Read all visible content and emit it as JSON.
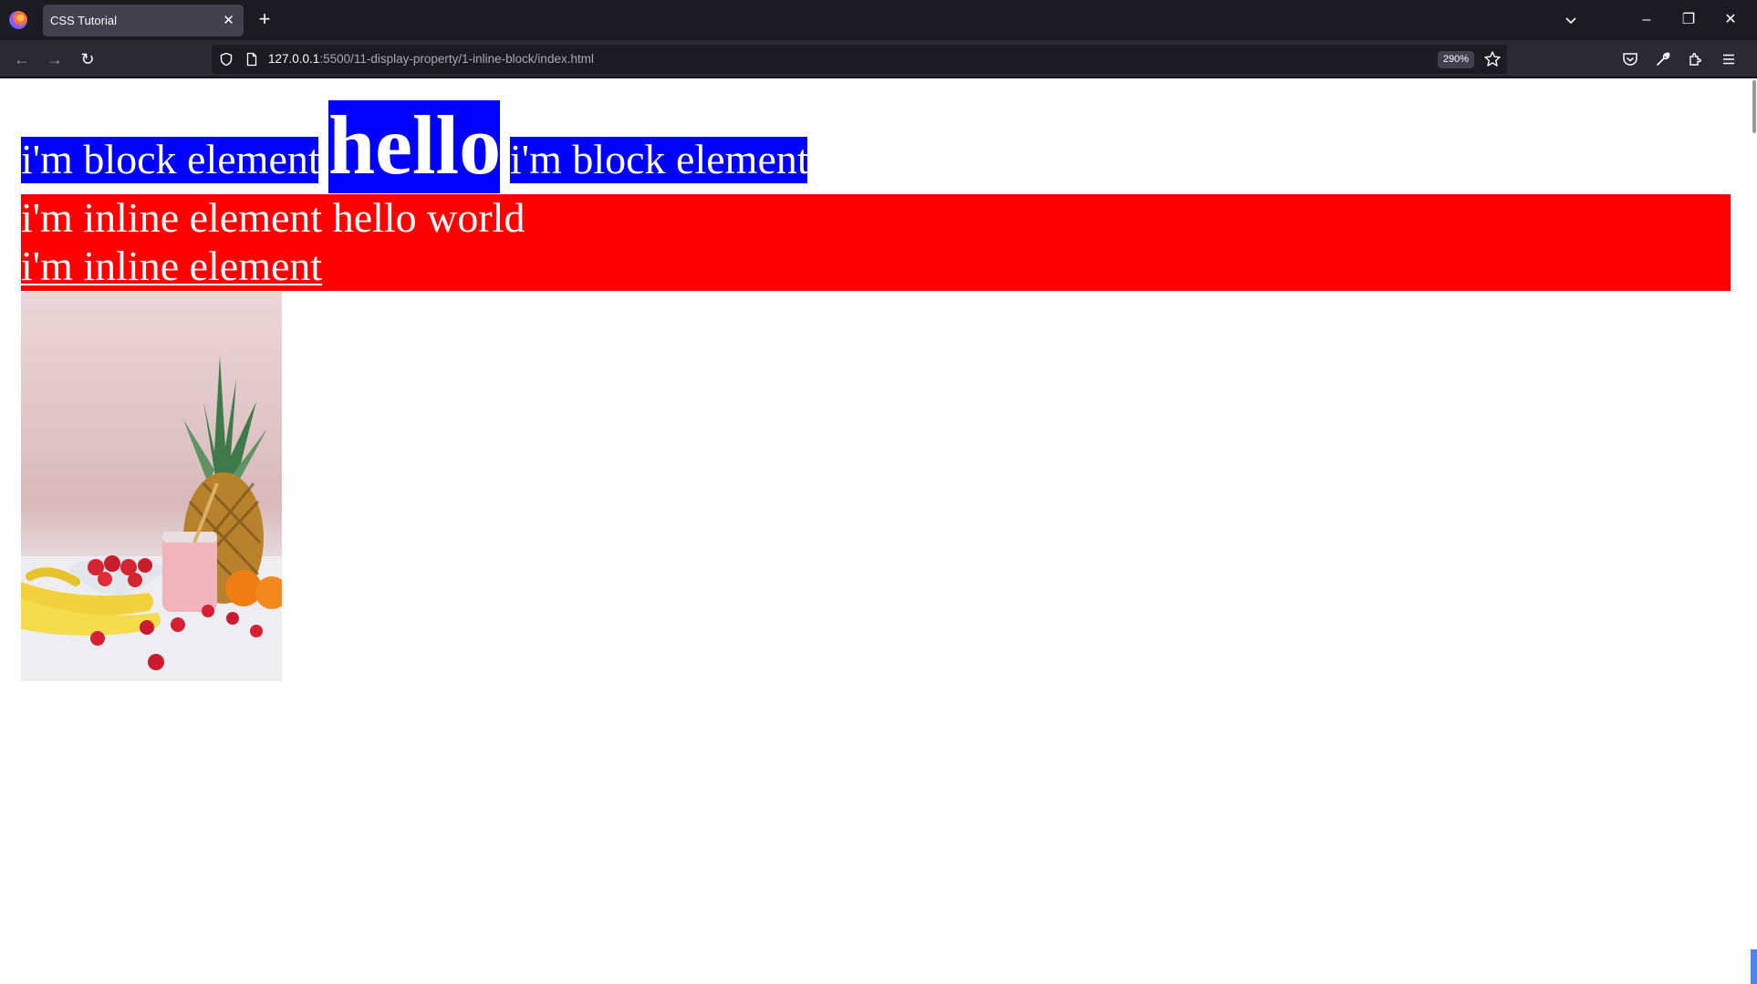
{
  "browser": {
    "tab": {
      "title": "CSS Tutorial",
      "close_glyph": "✕"
    },
    "new_tab_glyph": "+",
    "tablist_glyph": "⌄",
    "window_controls": {
      "minimize": "–",
      "restore": "❐",
      "close": "✕"
    },
    "nav": {
      "back_glyph": "←",
      "forward_glyph": "→",
      "reload_glyph": "↻"
    },
    "url": {
      "host": "127.0.0.1",
      "path": ":5500/11-display-property/1-inline-block/index.html"
    },
    "zoom_level": "290%",
    "icons": [
      "firefox-logo",
      "shield-icon",
      "page-icon",
      "star-icon",
      "pocket-icon",
      "wrench-icon",
      "extensions-icon",
      "menu-icon"
    ]
  },
  "page": {
    "blocks": [
      {
        "label": "i'm block element"
      },
      {
        "label": "hello"
      },
      {
        "label": "i'm block element"
      }
    ],
    "inline_lines": [
      {
        "label": "i'm inline element hello world"
      },
      {
        "label": "i'm inline element"
      }
    ],
    "colors": {
      "block_bg": "#0000ff",
      "inline_bg": "#ff0000",
      "text": "#ffffff",
      "chrome_dark": "#1c1b22",
      "chrome_nav": "#2b2a33",
      "tab_active": "#42414d"
    }
  }
}
